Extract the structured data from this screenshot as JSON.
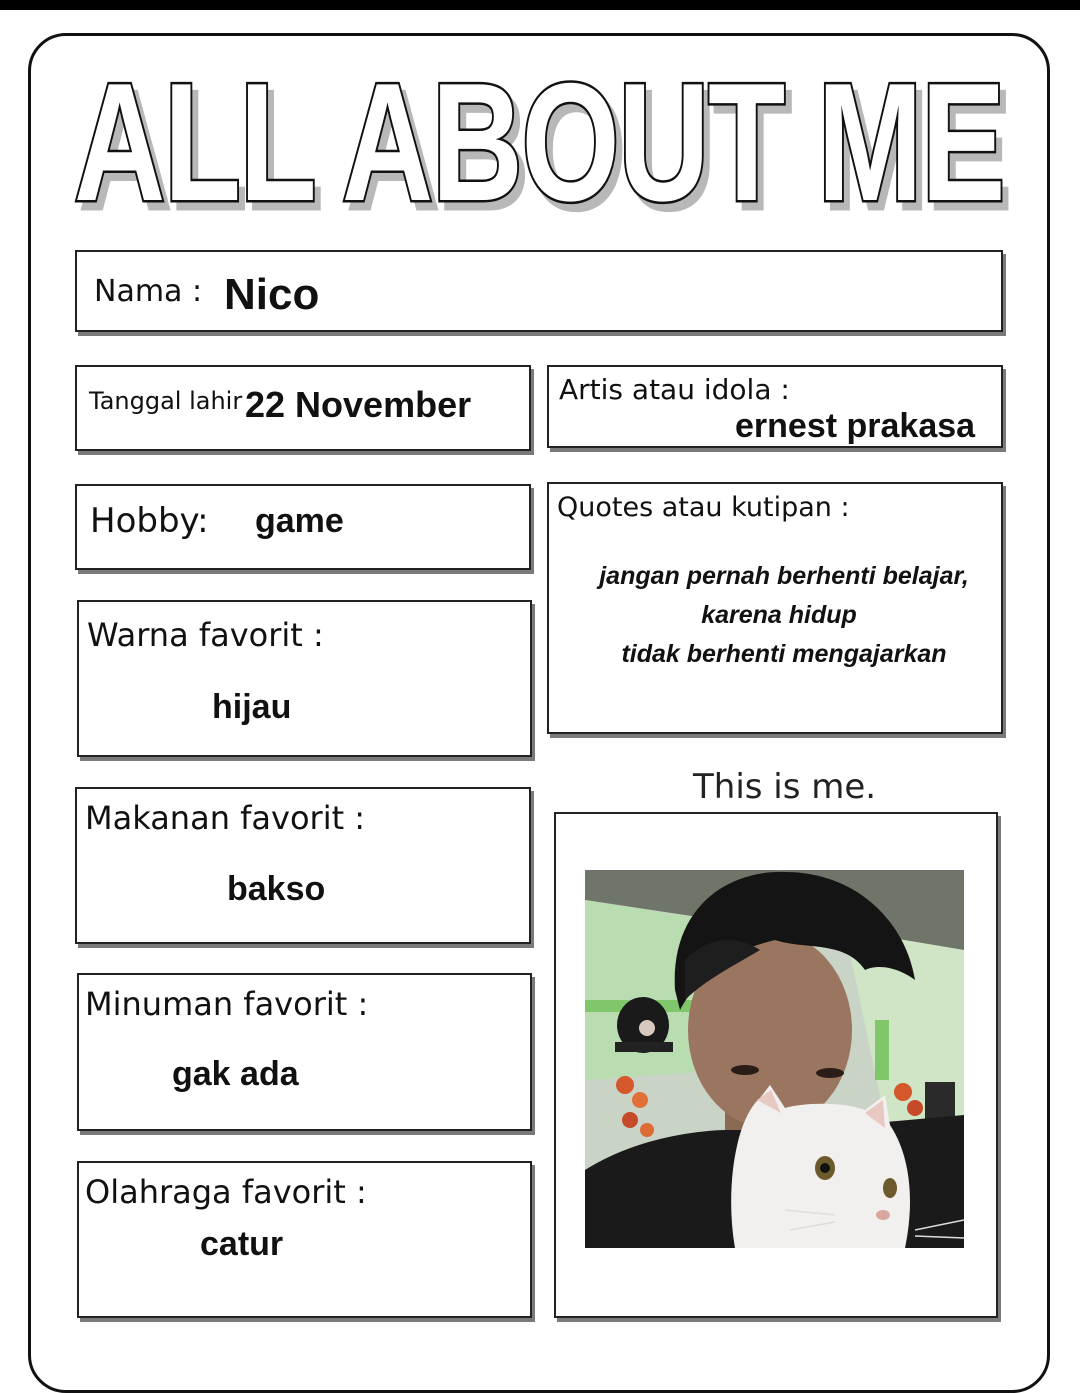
{
  "title": "ALL ABOUT ME",
  "fields": {
    "nama": {
      "label": "Nama :",
      "value": "Nico"
    },
    "tanggal_lahir": {
      "label": "Tanggal lahir",
      "value": "22 November"
    },
    "artis": {
      "label": "Artis atau idola :",
      "value": "ernest prakasa"
    },
    "hobby": {
      "label": "Hobby:",
      "value": "game"
    },
    "quotes": {
      "label": "Quotes atau kutipan :",
      "lines": [
        "jangan pernah berhenti belajar,",
        "karena hidup",
        "tidak berhenti mengajarkan"
      ]
    },
    "warna": {
      "label": "Warna favorit :",
      "value": "hijau"
    },
    "makanan": {
      "label": "Makanan favorit :",
      "value": "bakso"
    },
    "minuman": {
      "label": "Minuman favorit :",
      "value": "gak ada"
    },
    "olahraga": {
      "label": "Olahraga favorit :",
      "value": "catur"
    }
  },
  "photo": {
    "caption": "This is me."
  },
  "colors": {
    "border": "#222222",
    "shadow": "#7a7a7a",
    "wall_green": "#7fc76a"
  }
}
